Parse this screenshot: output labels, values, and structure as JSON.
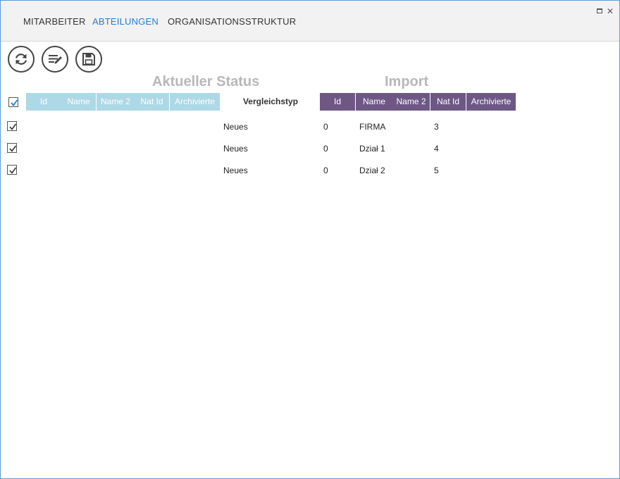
{
  "tabs": [
    {
      "label": "MITARBEITER",
      "active": false
    },
    {
      "label": "ABTEILUNGEN",
      "active": true
    },
    {
      "label": "ORGANISATIONSSTRUKTUR",
      "active": false
    }
  ],
  "window_controls": {
    "maximize_icon": "maximize-icon",
    "close_icon": "close-icon",
    "close_glyph": "✕"
  },
  "toolbar": {
    "refresh_icon": "refresh-icon",
    "edit_icon": "edit-list-icon",
    "save_icon": "save-icon"
  },
  "sections": {
    "current": "Aktueller Status",
    "import": "Import"
  },
  "select_all_checked": true,
  "current_columns": [
    "Id",
    "Name",
    "Name 2",
    "Nat Id",
    "Archivierte"
  ],
  "compare_column": "Vergleichstyp",
  "import_columns": [
    "Id",
    "Name",
    "Name 2",
    "Nat Id",
    "Archivierte"
  ],
  "rows": [
    {
      "checked": true,
      "compare": "Neues",
      "import": {
        "id": "0",
        "name": "FIRMA",
        "name2": "",
        "nat_id": "3",
        "archived": ""
      }
    },
    {
      "checked": true,
      "compare": "Neues",
      "import": {
        "id": "0",
        "name": "Dział 1",
        "name2": "",
        "nat_id": "4",
        "archived": ""
      }
    },
    {
      "checked": true,
      "compare": "Neues",
      "import": {
        "id": "0",
        "name": "Dział 2",
        "name2": "",
        "nat_id": "5",
        "archived": ""
      }
    }
  ],
  "colors": {
    "accent": "#1e7fd8",
    "current_header": "#add8e6",
    "import_header": "#6e5785",
    "section_title": "#b8b8b8"
  }
}
